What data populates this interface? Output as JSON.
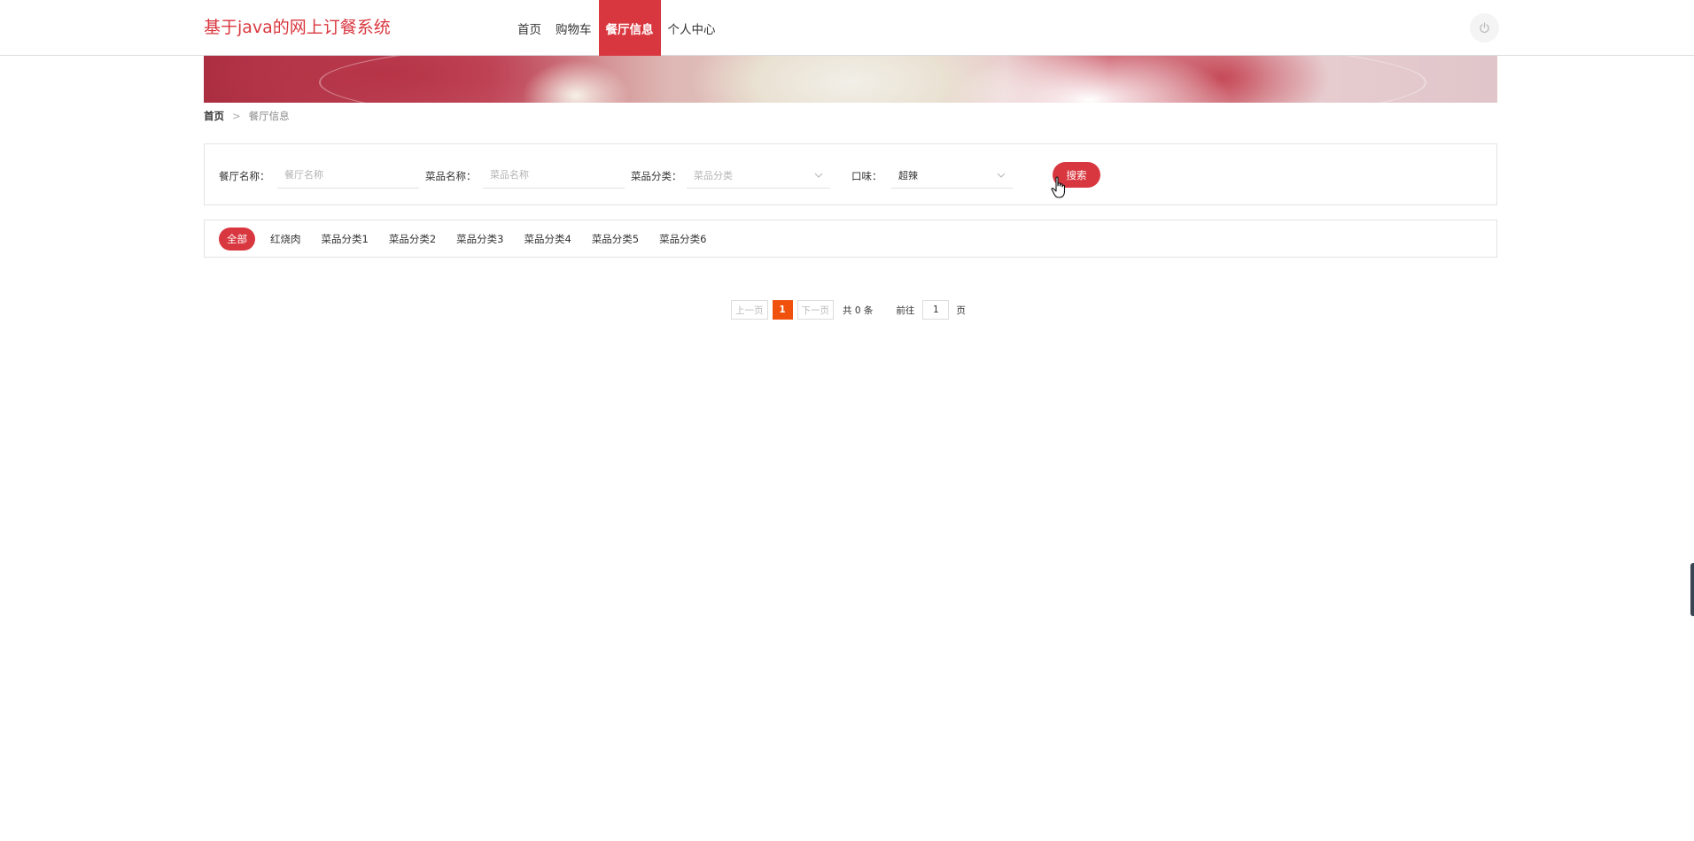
{
  "header": {
    "brand": "基于java的网上订餐系统",
    "nav": [
      {
        "label": "首页",
        "active": false
      },
      {
        "label": "购物车",
        "active": false
      },
      {
        "label": "餐厅信息",
        "active": true
      },
      {
        "label": "个人中心",
        "active": false
      }
    ],
    "power_icon": "power-icon",
    "accent_color": "#d9373f"
  },
  "breadcrumb": {
    "home": "首页",
    "separator": ">",
    "current": "餐厅信息"
  },
  "search": {
    "restaurant_label": "餐厅名称：",
    "restaurant_placeholder": "餐厅名称",
    "dish_label": "菜品名称：",
    "dish_placeholder": "菜品名称",
    "category_label": "菜品分类：",
    "category_placeholder": "菜品分类",
    "taste_label": "口味：",
    "taste_value": "超辣",
    "button": "搜索"
  },
  "categories": [
    "全部",
    "红烧肉",
    "菜品分类1",
    "菜品分类2",
    "菜品分类3",
    "菜品分类4",
    "菜品分类5",
    "菜品分类6"
  ],
  "pagination": {
    "prev": "上一页",
    "current_page": "1",
    "next": "下一页",
    "total": "共 0 条",
    "goto": "前往",
    "page_input": "1",
    "page_unit": "页",
    "active_color": "#f0520e"
  }
}
